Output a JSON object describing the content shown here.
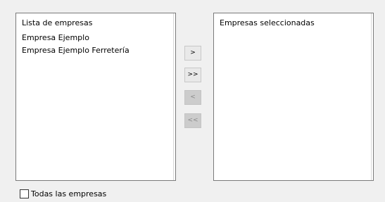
{
  "available": {
    "header": "Lista de empresas",
    "items": [
      "Empresa Ejemplo",
      "Empresa Ejemplo Ferretería"
    ]
  },
  "selected": {
    "header": "Empresas seleccionadas",
    "items": []
  },
  "buttons": {
    "add": ">",
    "add_all": ">>",
    "remove": "<",
    "remove_all": "<<"
  },
  "all_companies": {
    "label": "Todas las empresas",
    "checked": false
  }
}
